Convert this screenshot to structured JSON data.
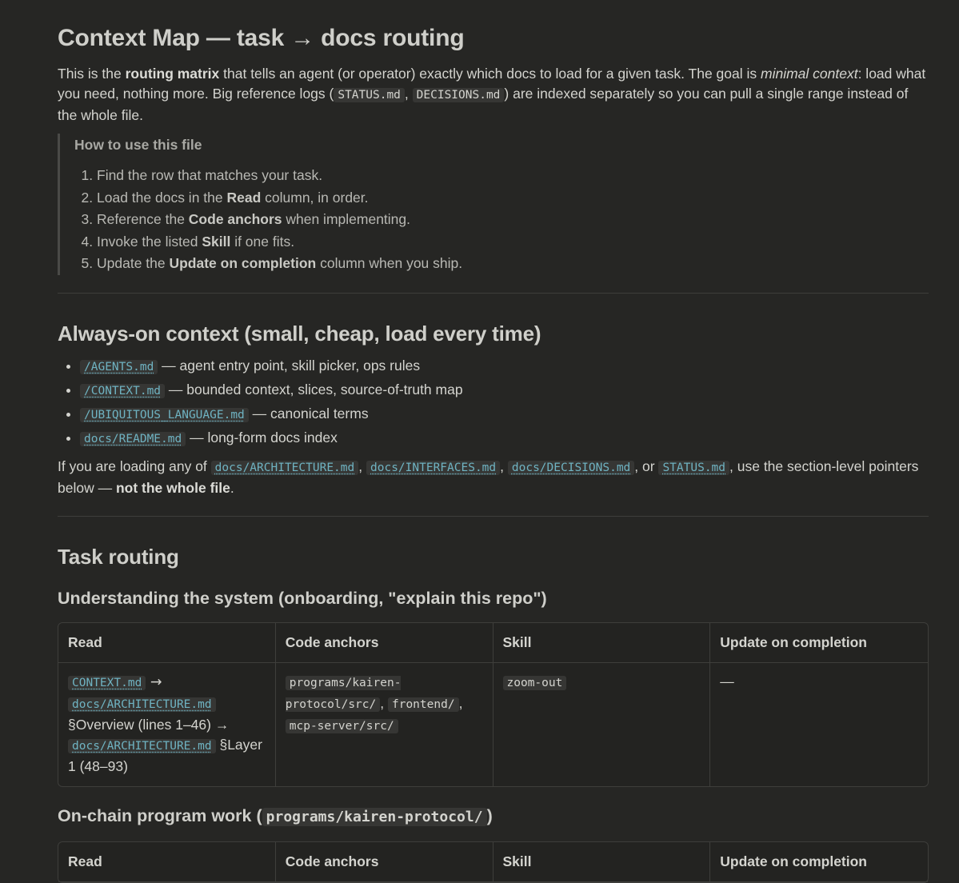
{
  "title": "Context Map — task → docs routing",
  "intro": {
    "t1": "This is the ",
    "b1": "routing matrix",
    "t2": " that tells an agent (or operator) exactly which docs to load for a given task. The goal is ",
    "i1": "minimal context",
    "t3": ": load what you need, nothing more. Big reference logs (",
    "c1": "STATUS.md",
    "t4": ", ",
    "c2": "DECISIONS.md",
    "t5": ") are indexed separately so you can pull a single range instead of the whole file."
  },
  "callout": {
    "title": "How to use this file",
    "steps": [
      {
        "pre": "Find the row that matches your task.",
        "bold": "",
        "post": ""
      },
      {
        "pre": "Load the docs in the ",
        "bold": "Read",
        "post": " column, in order."
      },
      {
        "pre": "Reference the ",
        "bold": "Code anchors",
        "post": " when implementing."
      },
      {
        "pre": "Invoke the listed ",
        "bold": "Skill",
        "post": " if one fits."
      },
      {
        "pre": "Update the ",
        "bold": "Update on completion",
        "post": " column when you ship."
      }
    ]
  },
  "always_on": {
    "heading": "Always-on context (small, cheap, load every time)",
    "items": [
      {
        "code": "/AGENTS.md",
        "desc": " — agent entry point, skill picker, ops rules"
      },
      {
        "code": "/CONTEXT.md",
        "desc": " — bounded context, slices, source-of-truth map"
      },
      {
        "code": "/UBIQUITOUS_LANGUAGE.md",
        "desc": " — canonical terms"
      },
      {
        "code": "docs/README.md",
        "desc": " — long-form docs index"
      }
    ],
    "note": {
      "t1": "If you are loading any of ",
      "c1": "docs/ARCHITECTURE.md",
      "t2": ", ",
      "c2": "docs/INTERFACES.md",
      "t3": ", ",
      "c3": "docs/DECISIONS.md",
      "t4": ", or ",
      "c4": "STATUS.md",
      "t5": ", use the section-level pointers below — ",
      "b1": "not the whole file",
      "t6": "."
    }
  },
  "task_routing": {
    "heading": "Task routing",
    "columns": [
      "Read",
      "Code anchors",
      "Skill",
      "Update on completion"
    ],
    "section1": {
      "heading": "Understanding the system (onboarding, \"explain this repo\")",
      "read": {
        "c1": "CONTEXT.md",
        "a1": " → ",
        "c2": "docs/ARCHITECTURE.md",
        "t1": " §Overview (lines 1–46) → ",
        "c3": "docs/ARCHITECTURE.md",
        "t2": " §Layer 1 (48–93)"
      },
      "anchors": {
        "c1": "programs/kairen-protocol/src/",
        "s1": ", ",
        "c2": "frontend/",
        "s2": ", ",
        "c3": "mcp-server/src/"
      },
      "skill": "zoom-out",
      "update": "—"
    },
    "section2": {
      "heading_pre": "On-chain program work (",
      "heading_code": "programs/kairen-protocol/",
      "heading_post": ")"
    }
  }
}
